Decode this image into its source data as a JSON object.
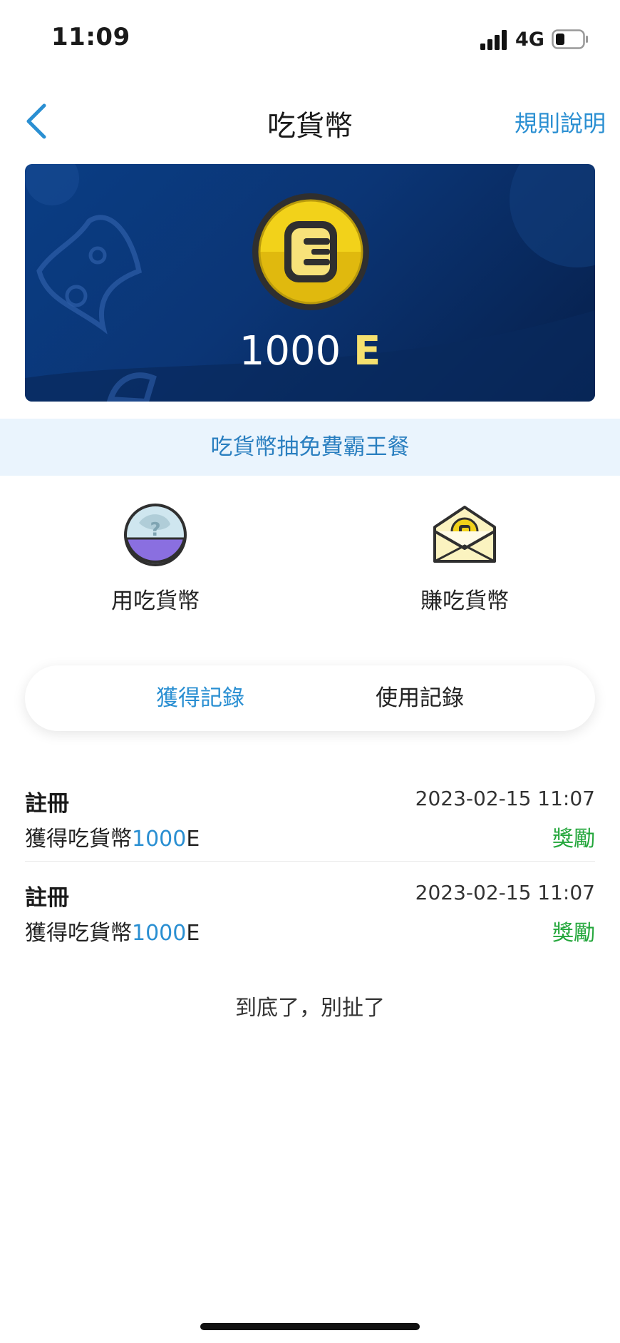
{
  "status": {
    "time": "11:09",
    "network": "4G"
  },
  "nav": {
    "title": "吃貨幣",
    "rules_label": "規則說明"
  },
  "balance": {
    "amount": "1000",
    "unit": "E"
  },
  "promo": {
    "label": "吃貨幣抽免費霸王餐"
  },
  "actions": {
    "use_label": "用吃貨幣",
    "earn_label": "賺吃貨幣"
  },
  "tabs": {
    "earned": "獲得記錄",
    "used": "使用記錄"
  },
  "records": [
    {
      "title": "註冊",
      "time": "2023-02-15 11:07",
      "desc_prefix": "獲得吃貨幣",
      "amount": "1000",
      "unit": "E",
      "tag": "獎勵"
    },
    {
      "title": "註冊",
      "time": "2023-02-15 11:07",
      "desc_prefix": "獲得吃貨幣",
      "amount": "1000",
      "unit": "E",
      "tag": "獎勵"
    }
  ],
  "end_text": "到底了，別扯了",
  "colors": {
    "accent": "#2a8fd2",
    "reward": "#22a63a",
    "banner": "#0b3575",
    "coin": "#f2d21a"
  }
}
